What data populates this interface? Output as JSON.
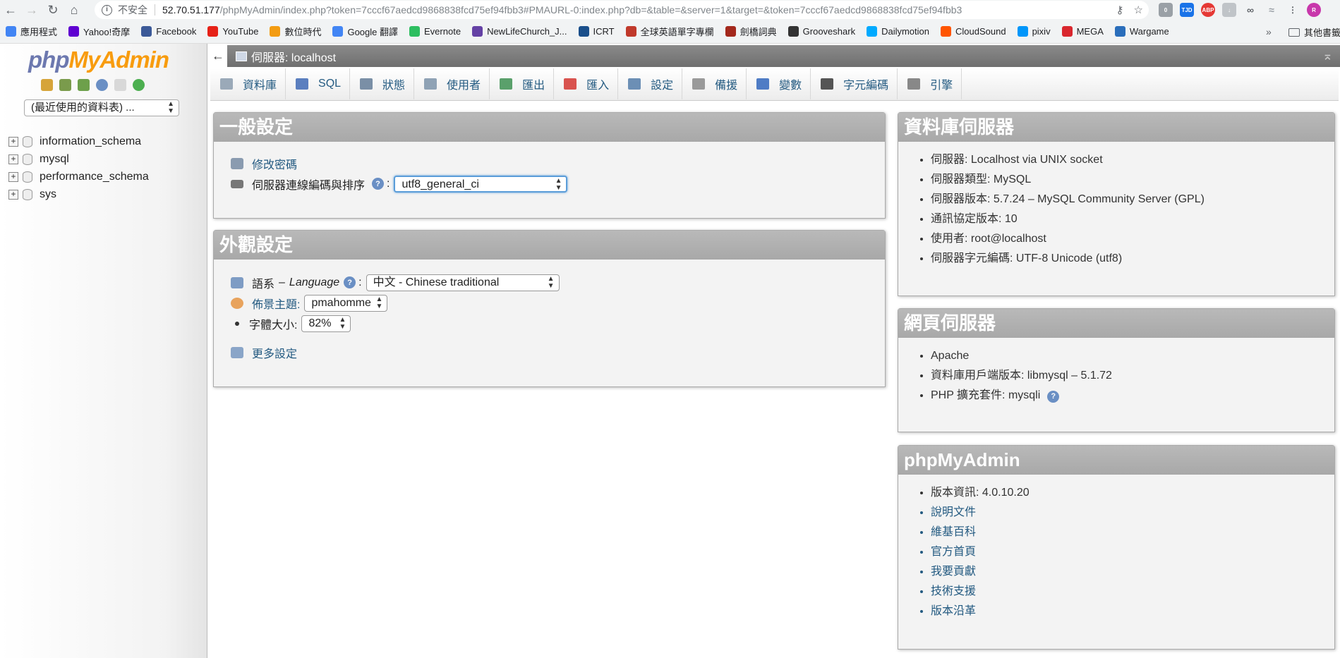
{
  "browser": {
    "insecure_label": "不安全",
    "url_host": "52.70.51.177",
    "url_path": "/phpMyAdmin/index.php?token=7cccf67aedcd9868838fcd75ef94fbb3#PMAURL-0:index.php?db=&table=&server=1&target=&token=7cccf67aedcd9868838fcd75ef94fbb3",
    "bookmarks": [
      {
        "label": "應用程式",
        "color": "#4285f4"
      },
      {
        "label": "Yahoo!奇摩",
        "color": "#5f01d1"
      },
      {
        "label": "Facebook",
        "color": "#3b5998"
      },
      {
        "label": "YouTube",
        "color": "#e62117"
      },
      {
        "label": "數位時代",
        "color": "#f39c12"
      },
      {
        "label": "Google 翻譯",
        "color": "#4285f4"
      },
      {
        "label": "Evernote",
        "color": "#2dbe60"
      },
      {
        "label": "NewLifeChurch_J...",
        "color": "#6441a5"
      },
      {
        "label": "ICRT",
        "color": "#1a4f8b"
      },
      {
        "label": "全球英語單字專欄",
        "color": "#c0392b"
      },
      {
        "label": "劍橋詞典",
        "color": "#a3281c"
      },
      {
        "label": "Grooveshark",
        "color": "#333333"
      },
      {
        "label": "Dailymotion",
        "color": "#00aaff"
      },
      {
        "label": "CloudSound",
        "color": "#ff5500"
      },
      {
        "label": "pixiv",
        "color": "#0096fa"
      },
      {
        "label": "MEGA",
        "color": "#d9272e"
      },
      {
        "label": "Wargame",
        "color": "#2a6ebb"
      }
    ],
    "more_label": "»",
    "other_bookmarks": "其他書籤"
  },
  "sidebar": {
    "logo_php": "php",
    "logo_myadmin": "MyAdmin",
    "recent_select": "(最近使用的資料表) ...",
    "databases": [
      "information_schema",
      "mysql",
      "performance_schema",
      "sys"
    ]
  },
  "serverbar": {
    "title": "伺服器: localhost"
  },
  "tabs": [
    {
      "label": "資料庫",
      "color": "#9aa9b8"
    },
    {
      "label": "SQL",
      "color": "#5b7fbf"
    },
    {
      "label": "狀態",
      "color": "#7a8fa6"
    },
    {
      "label": "使用者",
      "color": "#8fa2b5"
    },
    {
      "label": "匯出",
      "color": "#5aa06b"
    },
    {
      "label": "匯入",
      "color": "#d9534f"
    },
    {
      "label": "設定",
      "color": "#6c8fb5"
    },
    {
      "label": "備援",
      "color": "#9a9a9a"
    },
    {
      "label": "變數",
      "color": "#4f7cc5"
    },
    {
      "label": "字元編碼",
      "color": "#555555"
    },
    {
      "label": "引擎",
      "color": "#888888"
    }
  ],
  "general_settings": {
    "title": "一般設定",
    "change_password": "修改密碼",
    "collation_label": "伺服器連線編碼與排序",
    "collation_value": "utf8_general_ci",
    "help_glyph": "?"
  },
  "appearance_settings": {
    "title": "外觀設定",
    "language_label": "語系",
    "language_dash": "–",
    "language_en": "Language",
    "language_value": "中文 - Chinese traditional",
    "theme_label": "佈景主題:",
    "theme_value": "pmahomme",
    "font_size_label": "字體大小:",
    "font_size_value": "82%",
    "more_settings": "更多設定"
  },
  "db_server": {
    "title": "資料庫伺服器",
    "items": [
      "伺服器: Localhost via UNIX socket",
      "伺服器類型: MySQL",
      "伺服器版本: 5.7.24 – MySQL Community Server (GPL)",
      "通訊協定版本: 10",
      "使用者: root@localhost",
      "伺服器字元編碼: UTF-8 Unicode (utf8)"
    ]
  },
  "web_server": {
    "title": "網頁伺服器",
    "items": [
      "Apache",
      "資料庫用戶端版本: libmysql – 5.1.72",
      "PHP 擴充套件: mysqli"
    ]
  },
  "pma": {
    "title": "phpMyAdmin",
    "version": "版本資訊: 4.0.10.20",
    "links": [
      "說明文件",
      "維基百科",
      "官方首頁",
      "我要貢獻",
      "技術支援",
      "版本沿革"
    ]
  }
}
